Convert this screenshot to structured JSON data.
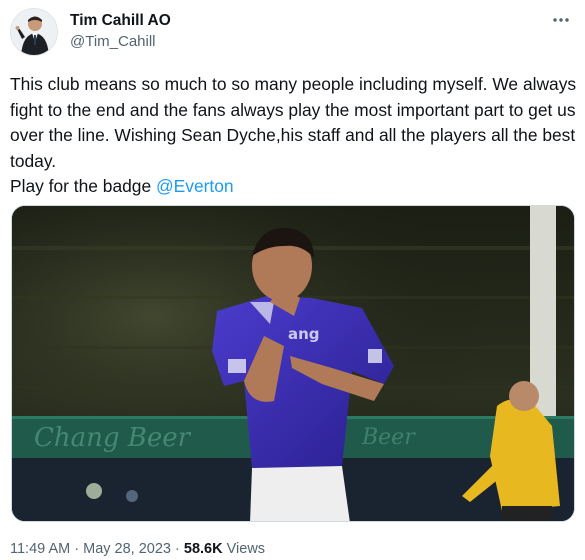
{
  "author": {
    "display_name": "Tim Cahill AO",
    "handle": "@Tim_Cahill"
  },
  "tweet": {
    "text_main": "This club means so much to so many people including myself. We always fight to the end and the fans always play the most important part to get us over the line. Wishing Sean Dyche,his staff and all the players all the best today.\nPlay for the badge ",
    "mention": "@Everton"
  },
  "meta": {
    "time": "11:49 AM",
    "separator": "·",
    "date": "May 28, 2023",
    "views_count": "58.6K",
    "views_label": "Views"
  },
  "colors": {
    "link": "#1d9bf0",
    "secondary_text": "#536471",
    "everton_blue": "#3b2bb8"
  },
  "icons": {
    "more": "more-horizontal-icon"
  }
}
